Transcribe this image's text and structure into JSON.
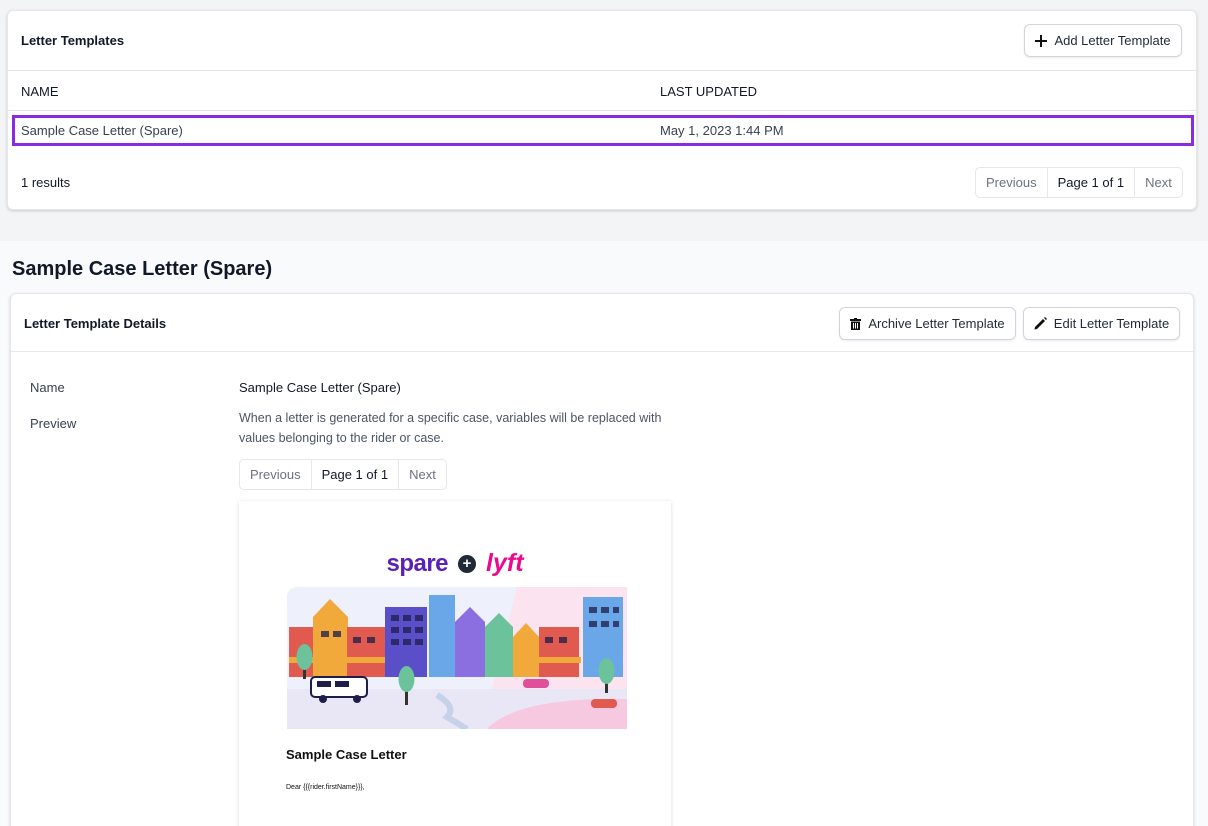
{
  "list": {
    "title": "Letter Templates",
    "add_button": "Add Letter Template",
    "columns": [
      "NAME",
      "LAST UPDATED"
    ],
    "rows": [
      {
        "name": "Sample Case Letter (Spare)",
        "updated": "May 1, 2023 1:44 PM"
      }
    ],
    "results": "1 results",
    "pager": {
      "prev": "Previous",
      "page": "Page 1 of 1",
      "next": "Next"
    }
  },
  "detail": {
    "title": "Sample Case Letter (Spare)",
    "card_title": "Letter Template Details",
    "archive_button": "Archive Letter Template",
    "edit_button": "Edit Letter Template",
    "name_label": "Name",
    "name_value": "Sample Case Letter (Spare)",
    "preview_label": "Preview",
    "preview_help": "When a letter is generated for a specific case, variables will be replaced with values belonging to the rider or case.",
    "pager": {
      "prev": "Previous",
      "page": "Page 1 of 1",
      "next": "Next"
    },
    "letter": {
      "logo_spare": "spare",
      "logo_lyft": "lyft",
      "heading": "Sample Case Letter",
      "greeting": "Dear {{{rider.firstName}}},"
    }
  },
  "colors": {
    "accent": "#8a2be2",
    "spare": "#5b21b6",
    "lyft": "#ea0b8c"
  },
  "icons": [
    "plus-icon",
    "trash-icon",
    "pencil-icon"
  ]
}
